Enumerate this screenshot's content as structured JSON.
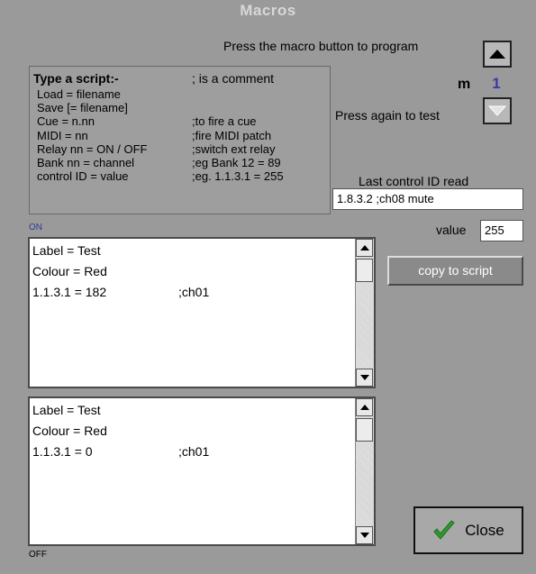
{
  "title": "Macros",
  "instruction": "Press the macro button to program",
  "press_again": "Press again to test",
  "macro": {
    "prefix": "m",
    "number": "1"
  },
  "help": {
    "heading": "Type a script:-",
    "comment_note": "; is a comment",
    "lines": [
      {
        "cmd": "Load = filename",
        "note": ""
      },
      {
        "cmd": "Save [= filename]",
        "note": ""
      },
      {
        "cmd": "Cue = n.nn",
        "note": ";to fire a cue"
      },
      {
        "cmd": "MIDI = nn",
        "note": ";fire MIDI patch"
      },
      {
        "cmd": "Relay nn = ON / OFF",
        "note": ";switch ext relay"
      },
      {
        "cmd": "Bank nn = channel",
        "note": ";eg Bank 12 = 89"
      },
      {
        "cmd": "control ID = value",
        "note": ";eg. 1.1.3.1 = 255"
      }
    ]
  },
  "last_control": {
    "label": "Last control ID read",
    "value": "1.8.3.2  ;ch08 mute"
  },
  "value": {
    "label": "value",
    "value": "255"
  },
  "copy_button": "copy to script",
  "on_script": {
    "label": "ON",
    "lines": [
      {
        "text": "Label = Test",
        "comment": ""
      },
      {
        "text": "Colour = Red",
        "comment": ""
      },
      {
        "text": "1.1.3.1 = 182",
        "comment": ";ch01"
      }
    ]
  },
  "off_script": {
    "label": "OFF",
    "lines": [
      {
        "text": "Label = Test",
        "comment": ""
      },
      {
        "text": "Colour = Red",
        "comment": ""
      },
      {
        "text": "1.1.3.1 = 0",
        "comment": ";ch01"
      }
    ]
  },
  "close_button": "Close",
  "colors": {
    "background": "#9a9a9a",
    "accent_blue": "#3a3aa8",
    "check_green": "#2e9a2e"
  }
}
